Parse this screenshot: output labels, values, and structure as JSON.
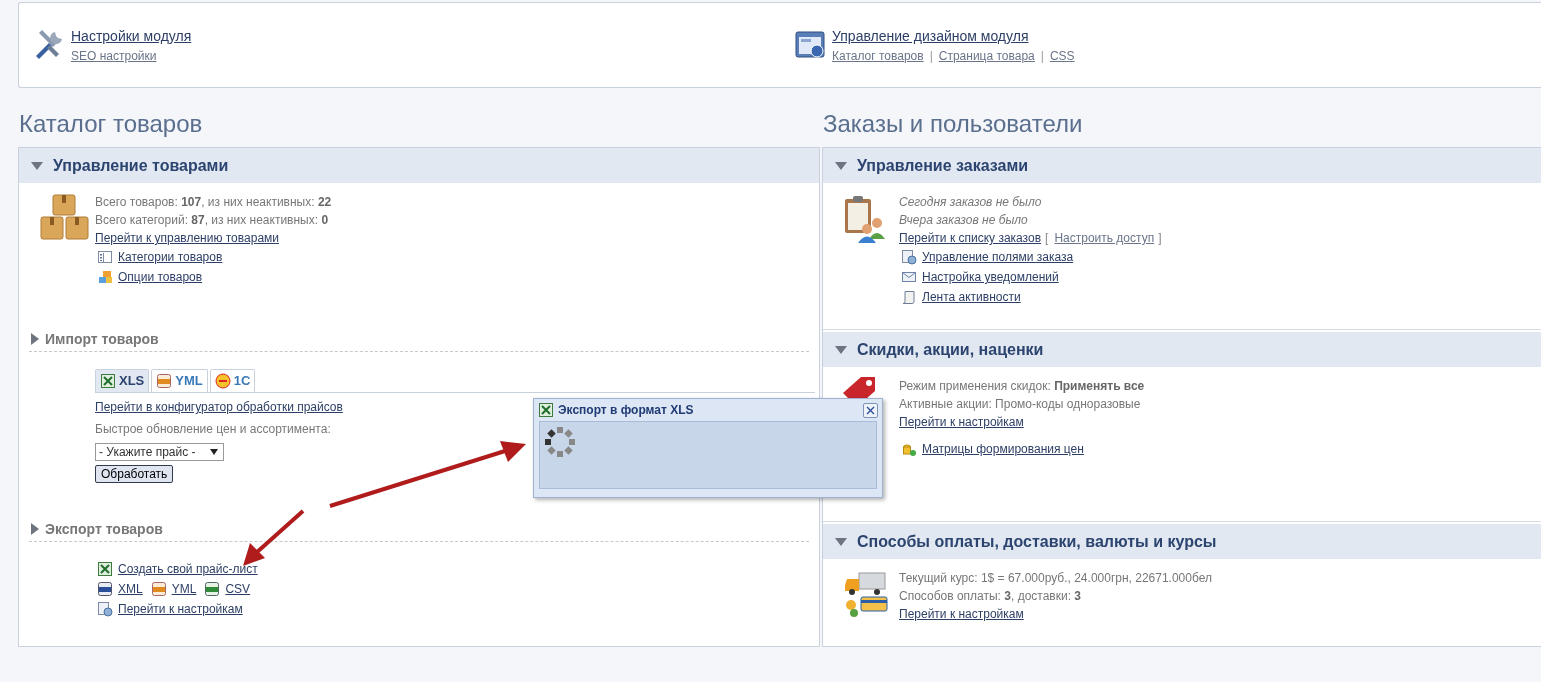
{
  "top_links": [
    {
      "title": "Настройки модуля",
      "links": [
        {
          "label": "SEO настройки"
        }
      ]
    },
    {
      "title": "Управление дизайном модуля",
      "links": [
        {
          "label": "Каталог товаров"
        },
        {
          "sep": "|",
          "label": "Страница товара"
        },
        {
          "sep": "|",
          "label": "CSS"
        }
      ]
    }
  ],
  "columns": [
    {
      "heading": "Каталог товаров",
      "sections": [
        {
          "kind": "panel",
          "title": "Управление товарами",
          "expanded": true,
          "lines": [
            {
              "kind": "text",
              "text": "Всего товаров: **107**, из них неактивных: **22**"
            },
            {
              "kind": "text",
              "text": "Всего категорий: **87**, из них неактивных: **0**"
            },
            {
              "kind": "link",
              "text": "Перейти к управлению товарами"
            },
            {
              "kind": "icon_links",
              "links": [
                {
                  "label": "Категории товаров"
                }
              ]
            },
            {
              "kind": "icon_links",
              "links": [
                {
                  "label": "Опции товаров"
                }
              ]
            }
          ]
        },
        {
          "kind": "group",
          "title": "Импорт товаров",
          "expanded": false,
          "lines": [
            {
              "kind": "tabs",
              "tabs": [
                {
                  "label": "XLS",
                  "selected": true
                },
                {
                  "label": "YML",
                  "selected": false
                },
                {
                  "label": "1C",
                  "selected": false
                }
              ]
            },
            {
              "kind": "link",
              "text": "Перейти в конфигуратор обработки прайсов"
            },
            {
              "kind": "text",
              "text": "Быстрое обновление цен и ассортимента:"
            },
            {
              "kind": "select",
              "value": "- Укажите прайс -"
            },
            {
              "kind": "button",
              "text": "Обработать"
            }
          ]
        },
        {
          "kind": "group",
          "title": "Экспорт товаров",
          "expanded": false,
          "lines": [
            {
              "kind": "icon_links",
              "links": [
                {
                  "label": "Создать свой прайс-лист"
                }
              ]
            },
            {
              "kind": "icon_links",
              "links": [
                {
                  "label": "XML"
                },
                {
                  "label": "YML"
                },
                {
                  "label": "CSV"
                }
              ]
            },
            {
              "kind": "icon_links",
              "links": [
                {
                  "label": "Перейти к настройкам"
                }
              ]
            }
          ]
        }
      ]
    },
    {
      "heading": "Заказы и пользователи",
      "sections": [
        {
          "kind": "panel",
          "title": "Управление заказами",
          "expanded": true,
          "lines": [
            {
              "kind": "note",
              "text": "Сегодня заказов не было"
            },
            {
              "kind": "note",
              "text": "Вчера заказов не было"
            },
            {
              "kind": "link_extra",
              "text": "Перейти к списку заказов",
              "open": "[",
              "extra": "Настроить доступ",
              "close": "]"
            },
            {
              "kind": "icon_links",
              "links": [
                {
                  "label": "Управление полями заказа"
                }
              ]
            },
            {
              "kind": "icon_links",
              "links": [
                {
                  "label": "Настройка уведомлений"
                }
              ]
            },
            {
              "kind": "icon_links",
              "links": [
                {
                  "label": "Лента активности"
                }
              ]
            }
          ]
        },
        {
          "kind": "panel",
          "title": "Скидки, акции, наценки",
          "expanded": true,
          "lines": [
            {
              "kind": "text",
              "text": "Режим применения скидок: **Применять все**"
            },
            {
              "kind": "text",
              "text": "Активные акции: Промо-коды одноразовые"
            },
            {
              "kind": "link",
              "text": "Перейти к настройкам"
            },
            {
              "kind": "icon_links",
              "links": [
                {
                  "label": "Матрицы формирования цен"
                }
              ]
            }
          ]
        },
        {
          "kind": "panel",
          "title": "Способы оплаты, доставки, валюты и курсы",
          "expanded": true,
          "lines": [
            {
              "kind": "text",
              "text": "Текущий курс: 1$ = 67.000руб., 24.000грн, 22671.000бел"
            },
            {
              "kind": "text",
              "text": "Способов оплаты: **3**, доставки: **3**"
            },
            {
              "kind": "link",
              "text": "Перейти к настройкам"
            }
          ]
        }
      ]
    }
  ],
  "dialog": {
    "title": "Экспорт в формат XLS"
  }
}
